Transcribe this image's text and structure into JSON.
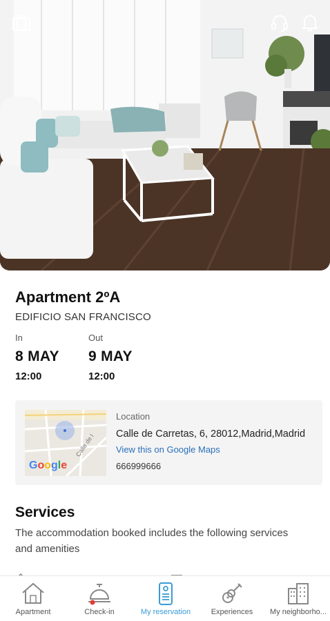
{
  "hero": {
    "icons": [
      "luggage-icon",
      "headset-icon",
      "bell-icon"
    ]
  },
  "reservation": {
    "title": "Apartment 2ºA",
    "building": "EDIFICIO SAN FRANCISCO",
    "check_in": {
      "label": "In",
      "date": "8 MAY",
      "time": "12:00"
    },
    "check_out": {
      "label": "Out",
      "date": "9 MAY",
      "time": "12:00"
    }
  },
  "location": {
    "label": "Location",
    "address": "Calle de Carretas, 6, 28012,Madrid,Madrid",
    "map_link": "View this on Google Maps",
    "phone": "666999666",
    "map_brand": "Google",
    "map_street": "Calle de l"
  },
  "services": {
    "title": "Services",
    "description": "The accommodation booked includes the following services and amenities"
  },
  "bottom_nav": {
    "items": [
      {
        "label": "Apartment",
        "icon": "house-icon",
        "active": false
      },
      {
        "label": "Check-in",
        "icon": "service-bell-icon",
        "active": false,
        "badge": true
      },
      {
        "label": "My reservation",
        "icon": "keycard-icon",
        "active": true
      },
      {
        "label": "Experiences",
        "icon": "guitar-icon",
        "active": false
      },
      {
        "label": "My neighborho...",
        "icon": "buildings-icon",
        "active": false
      }
    ]
  },
  "colors": {
    "accent": "#3a9bd5",
    "link": "#2a6fba",
    "badge": "#e53935",
    "card_bg": "#f4f4f4"
  }
}
